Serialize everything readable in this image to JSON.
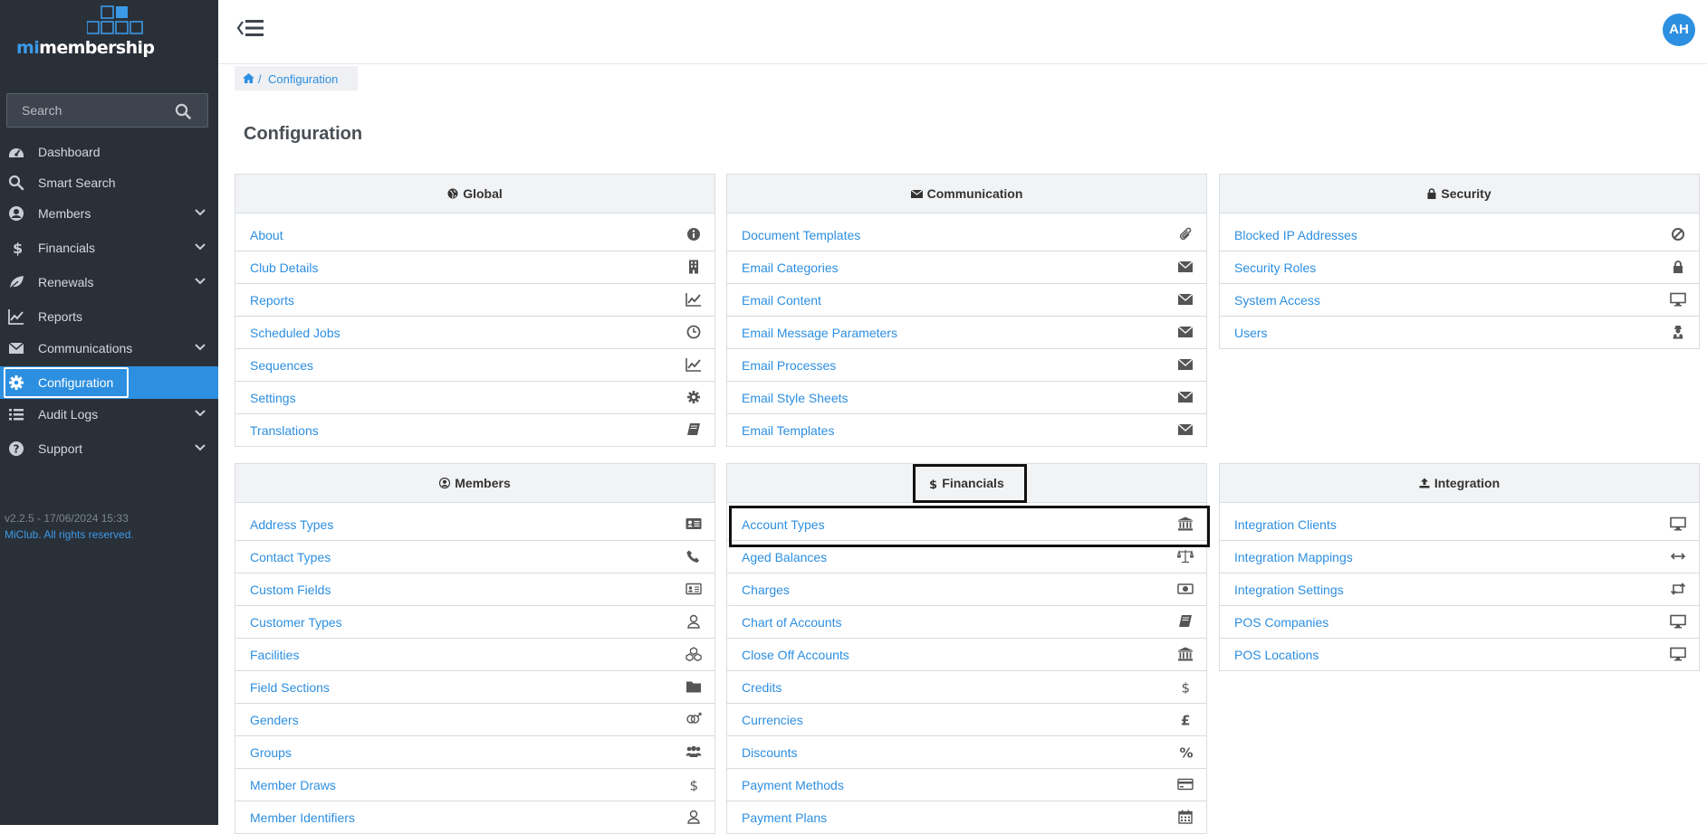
{
  "brand": {
    "mi": "mi",
    "membership": "membership"
  },
  "search": {
    "placeholder": "Search"
  },
  "nav": [
    {
      "label": "Dashboard",
      "icon": "dashboard-icon"
    },
    {
      "label": "Smart Search",
      "icon": "search-icon"
    },
    {
      "label": "Members",
      "icon": "user-circle-icon"
    },
    {
      "label": "Financials",
      "icon": "dollar-icon"
    },
    {
      "label": "Renewals",
      "icon": "leaf-icon"
    },
    {
      "label": "Reports",
      "icon": "line-chart-icon"
    },
    {
      "label": "Communications",
      "icon": "envelope-icon"
    },
    {
      "label": "Configuration",
      "icon": "gear-icon"
    },
    {
      "label": "Audit Logs",
      "icon": "list-icon"
    },
    {
      "label": "Support",
      "icon": "question-circle-icon"
    }
  ],
  "version": {
    "line1": "v2.2.5 - 17/06/2024 15:33",
    "line2": "MiClub. All rights reserved."
  },
  "user": {
    "initials": "AH"
  },
  "breadcrumb": {
    "separator": "/",
    "current": "Configuration"
  },
  "page": {
    "title": "Configuration"
  },
  "panels": {
    "global": {
      "title": "Global",
      "icon": "globe-icon",
      "items": [
        {
          "label": "About",
          "icon": "info-icon"
        },
        {
          "label": "Club Details",
          "icon": "building-icon"
        },
        {
          "label": "Reports",
          "icon": "line-chart-icon"
        },
        {
          "label": "Scheduled Jobs",
          "icon": "clock-icon"
        },
        {
          "label": "Sequences",
          "icon": "line-chart-icon"
        },
        {
          "label": "Settings",
          "icon": "gear-icon"
        },
        {
          "label": "Translations",
          "icon": "book-icon"
        }
      ]
    },
    "communication": {
      "title": "Communication",
      "icon": "envelope-icon",
      "items": [
        {
          "label": "Document Templates",
          "icon": "paperclip-icon"
        },
        {
          "label": "Email Categories",
          "icon": "envelope-icon"
        },
        {
          "label": "Email Content",
          "icon": "envelope-icon"
        },
        {
          "label": "Email Message Parameters",
          "icon": "envelope-icon"
        },
        {
          "label": "Email Processes",
          "icon": "envelope-icon"
        },
        {
          "label": "Email Style Sheets",
          "icon": "envelope-icon"
        },
        {
          "label": "Email Templates",
          "icon": "envelope-icon"
        }
      ]
    },
    "security": {
      "title": "Security",
      "icon": "lock-icon",
      "items": [
        {
          "label": "Blocked IP Addresses",
          "icon": "ban-icon"
        },
        {
          "label": "Security Roles",
          "icon": "lock-icon"
        },
        {
          "label": "System Access",
          "icon": "desktop-icon"
        },
        {
          "label": "Users",
          "icon": "user-secret-icon"
        }
      ]
    },
    "members": {
      "title": "Members",
      "icon": "user-circle-icon",
      "items": [
        {
          "label": "Address Types",
          "icon": "address-card-icon"
        },
        {
          "label": "Contact Types",
          "icon": "phone-icon"
        },
        {
          "label": "Custom Fields",
          "icon": "id-card-icon"
        },
        {
          "label": "Customer Types",
          "icon": "user-outline-icon"
        },
        {
          "label": "Facilities",
          "icon": "cubes-icon"
        },
        {
          "label": "Field Sections",
          "icon": "folder-icon"
        },
        {
          "label": "Genders",
          "icon": "genderless-icon"
        },
        {
          "label": "Groups",
          "icon": "users-icon"
        },
        {
          "label": "Member Draws",
          "icon": "dollar-icon"
        },
        {
          "label": "Member Identifiers",
          "icon": "user-outline-icon"
        }
      ]
    },
    "financials": {
      "title": "Financials",
      "icon": "dollar-icon",
      "items": [
        {
          "label": "Account Types",
          "icon": "bank-icon"
        },
        {
          "label": "Aged Balances",
          "icon": "balance-scale-icon"
        },
        {
          "label": "Charges",
          "icon": "money-icon"
        },
        {
          "label": "Chart of Accounts",
          "icon": "book-icon"
        },
        {
          "label": "Close Off Accounts",
          "icon": "bank-icon"
        },
        {
          "label": "Credits",
          "icon": "dollar-icon"
        },
        {
          "label": "Currencies",
          "icon": "pound-icon"
        },
        {
          "label": "Discounts",
          "icon": "percent-icon"
        },
        {
          "label": "Payment Methods",
          "icon": "credit-card-icon"
        },
        {
          "label": "Payment Plans",
          "icon": "calendar-icon"
        }
      ]
    },
    "integration": {
      "title": "Integration",
      "icon": "upload-icon",
      "items": [
        {
          "label": "Integration Clients",
          "icon": "desktop-icon"
        },
        {
          "label": "Integration Mappings",
          "icon": "arrows-h-icon"
        },
        {
          "label": "Integration Settings",
          "icon": "retweet-icon"
        },
        {
          "label": "POS Companies",
          "icon": "desktop-icon"
        },
        {
          "label": "POS Locations",
          "icon": "desktop-icon"
        }
      ]
    }
  }
}
